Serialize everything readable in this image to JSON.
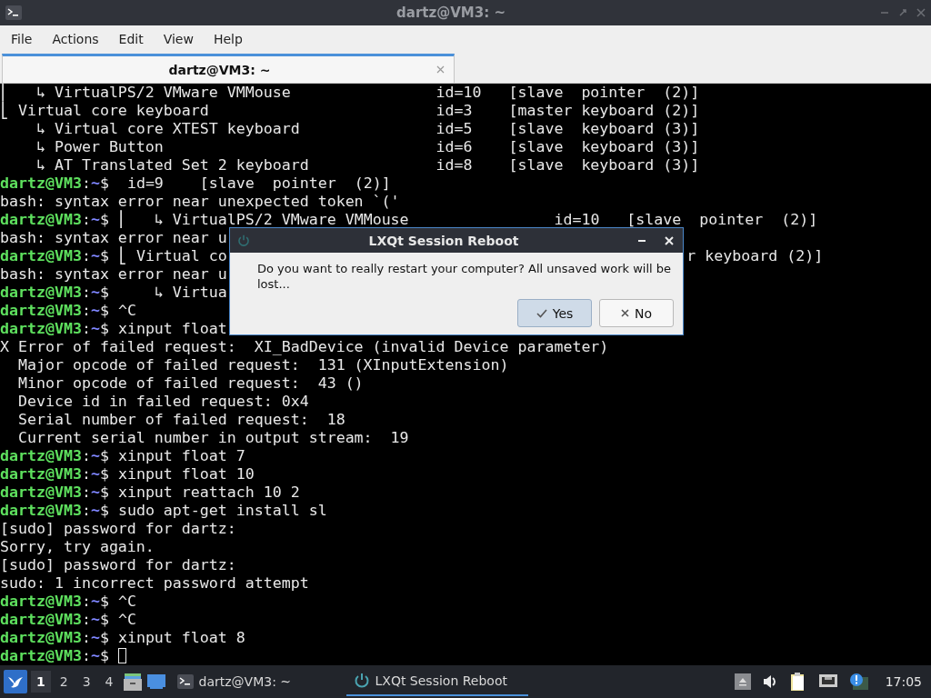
{
  "window": {
    "title": "dartz@VM3: ~"
  },
  "menu": [
    "File",
    "Actions",
    "Edit",
    "View",
    "Help"
  ],
  "tabs": [
    {
      "label": "dartz@VM3: ~",
      "selected": true
    }
  ],
  "terminal": {
    "lines": [
      {
        "kind": "output",
        "text": "⎜   ↳ VirtualPS/2 VMware VMMouse                id=10   [slave  pointer  (2)]"
      },
      {
        "kind": "output",
        "text": "⎣ Virtual core keyboard                         id=3    [master keyboard (2)]"
      },
      {
        "kind": "output",
        "text": "    ↳ Virtual core XTEST keyboard               id=5    [slave  keyboard (3)]"
      },
      {
        "kind": "output",
        "text": "    ↳ Power Button                              id=6    [slave  keyboard (3)]"
      },
      {
        "kind": "output",
        "text": "    ↳ AT Translated Set 2 keyboard              id=8    [slave  keyboard (3)]"
      },
      {
        "kind": "prompt",
        "prompt": [
          "dartz@VM3",
          ":",
          "~",
          "$"
        ],
        "text": "  id=9    [slave  pointer  (2)]"
      },
      {
        "kind": "output",
        "text": "bash: syntax error near unexpected token `('"
      },
      {
        "kind": "prompt",
        "prompt": [
          "dartz@VM3",
          ":",
          "~",
          "$"
        ],
        "text": " ⎜   ↳ VirtualPS/2 VMware VMMouse                id=10   [slave  pointer  (2)]"
      },
      {
        "kind": "output",
        "text": "bash: syntax error near u"
      },
      {
        "kind": "prompt",
        "prompt": [
          "dartz@VM3",
          ":",
          "~",
          "$"
        ],
        "text": " ⎣ Virtual co",
        "tail": "r keyboard (2)]"
      },
      {
        "kind": "output",
        "text": "bash: syntax error near u"
      },
      {
        "kind": "prompt",
        "prompt": [
          "dartz@VM3",
          ":",
          "~",
          "$"
        ],
        "text": "     ↳ Virtua"
      },
      {
        "kind": "prompt",
        "prompt": [
          "dartz@VM3",
          ":",
          "~",
          "$"
        ],
        "text": " ^C"
      },
      {
        "kind": "prompt",
        "prompt": [
          "dartz@VM3",
          ":",
          "~",
          "$"
        ],
        "text": " xinput float"
      },
      {
        "kind": "output",
        "text": "X Error of failed request:  XI_BadDevice (invalid Device parameter)"
      },
      {
        "kind": "output",
        "text": "  Major opcode of failed request:  131 (XInputExtension)"
      },
      {
        "kind": "output",
        "text": "  Minor opcode of failed request:  43 ()"
      },
      {
        "kind": "output",
        "text": "  Device id in failed request: 0x4"
      },
      {
        "kind": "output",
        "text": "  Serial number of failed request:  18"
      },
      {
        "kind": "output",
        "text": "  Current serial number in output stream:  19"
      },
      {
        "kind": "prompt",
        "prompt": [
          "dartz@VM3",
          ":",
          "~",
          "$"
        ],
        "text": " xinput float 7"
      },
      {
        "kind": "prompt",
        "prompt": [
          "dartz@VM3",
          ":",
          "~",
          "$"
        ],
        "text": " xinput float 10"
      },
      {
        "kind": "prompt",
        "prompt": [
          "dartz@VM3",
          ":",
          "~",
          "$"
        ],
        "text": " xinput reattach 10 2"
      },
      {
        "kind": "prompt",
        "prompt": [
          "dartz@VM3",
          ":",
          "~",
          "$"
        ],
        "text": " sudo apt-get install sl"
      },
      {
        "kind": "output",
        "text": "[sudo] password for dartz:"
      },
      {
        "kind": "output",
        "text": "Sorry, try again."
      },
      {
        "kind": "output",
        "text": "[sudo] password for dartz:"
      },
      {
        "kind": "output",
        "text": "sudo: 1 incorrect password attempt"
      },
      {
        "kind": "prompt",
        "prompt": [
          "dartz@VM3",
          ":",
          "~",
          "$"
        ],
        "text": " ^C"
      },
      {
        "kind": "prompt",
        "prompt": [
          "dartz@VM3",
          ":",
          "~",
          "$"
        ],
        "text": " ^C"
      },
      {
        "kind": "prompt",
        "prompt": [
          "dartz@VM3",
          ":",
          "~",
          "$"
        ],
        "text": " xinput float 8"
      },
      {
        "kind": "prompt",
        "prompt": [
          "dartz@VM3",
          ":",
          "~",
          "$"
        ],
        "cursor": true
      }
    ]
  },
  "dialog": {
    "title": "LXQt Session Reboot",
    "message": "Do you want to really restart your computer? All unsaved work will be lost...",
    "buttons": [
      {
        "label": "Yes",
        "kind": "confirm",
        "selected": true
      },
      {
        "label": "No",
        "kind": "cancel",
        "selected": false
      }
    ]
  },
  "taskbar": {
    "desktops": [
      {
        "label": "1",
        "selected": true
      },
      {
        "label": "2",
        "selected": false
      },
      {
        "label": "3",
        "selected": false
      },
      {
        "label": "4",
        "selected": false
      }
    ],
    "tasks": [
      {
        "label": "dartz@VM3: ~",
        "kind": "terminal",
        "selected": false
      },
      {
        "label": "LXQt Session Reboot",
        "kind": "dialog",
        "selected": true
      }
    ],
    "clock": "17:05"
  }
}
